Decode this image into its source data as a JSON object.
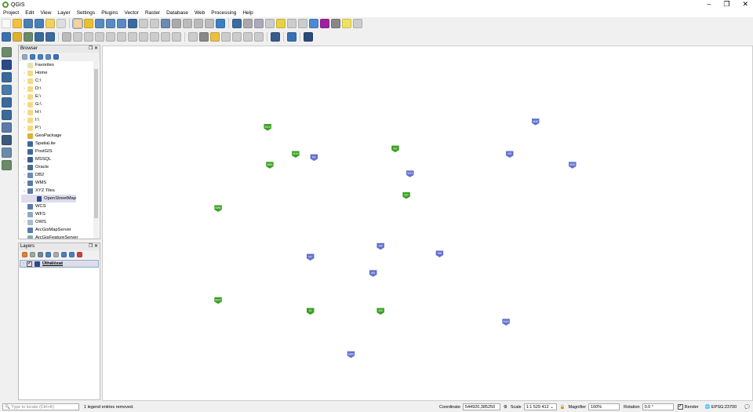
{
  "window": {
    "title": "QGIS",
    "minimize": "–",
    "restore": "❐",
    "close": "✕"
  },
  "menu": [
    "Project",
    "Edit",
    "View",
    "Layer",
    "Settings",
    "Plugins",
    "Vector",
    "Raster",
    "Database",
    "Web",
    "Processing",
    "Help"
  ],
  "toolbar1": [
    {
      "name": "new-project-icon",
      "color": "#f8f8f8"
    },
    {
      "name": "open-project-icon",
      "color": "#f0c040"
    },
    {
      "name": "save-project-icon",
      "color": "#4a7fb5"
    },
    {
      "name": "save-as-icon",
      "color": "#4a7fb5"
    },
    {
      "name": "new-print-layout-icon",
      "color": "#f0d060"
    },
    {
      "name": "layout-manager-icon",
      "color": "#ddd"
    },
    {
      "sep": true
    },
    {
      "name": "pan-icon",
      "color": "#f5d0a0",
      "sel": true
    },
    {
      "name": "pan-to-selection-icon",
      "color": "#e8c030"
    },
    {
      "name": "zoom-in-icon",
      "color": "#5a8ac0"
    },
    {
      "name": "zoom-out-icon",
      "color": "#5a8ac0"
    },
    {
      "name": "zoom-native-icon",
      "color": "#5a8ac0"
    },
    {
      "name": "zoom-full-icon",
      "color": "#3a6aa0"
    },
    {
      "name": "zoom-selection-icon",
      "color": "#ccc"
    },
    {
      "name": "zoom-layer-icon",
      "color": "#ccc"
    },
    {
      "name": "zoom-last-icon",
      "color": "#6a8ab0"
    },
    {
      "name": "zoom-next-icon",
      "color": "#aaa"
    },
    {
      "name": "new-map-view-icon",
      "color": "#bbb"
    },
    {
      "name": "new-3d-view-icon",
      "color": "#bbb"
    },
    {
      "name": "bookmarks-icon",
      "color": "#bbb"
    },
    {
      "name": "refresh-icon",
      "color": "#3a80c0"
    },
    {
      "sep": true
    },
    {
      "name": "identify-icon",
      "color": "#3a6aa0"
    },
    {
      "name": "action-icon",
      "color": "#aaa"
    },
    {
      "name": "select-icon",
      "color": "#aab"
    },
    {
      "name": "deselect-icon",
      "color": "#ccc"
    },
    {
      "name": "attribute-table-icon",
      "color": "#e8d040"
    },
    {
      "name": "field-calc-icon",
      "color": "#ccc"
    },
    {
      "name": "stats-icon",
      "color": "#ccc"
    },
    {
      "name": "toolbox-icon",
      "color": "#4a8ad0"
    },
    {
      "name": "sigma-icon",
      "color": "#a020a0"
    },
    {
      "name": "measure-icon",
      "color": "#888"
    },
    {
      "name": "map-tips-icon",
      "color": "#f0e060"
    },
    {
      "name": "text-annotation-icon",
      "color": "#ccc"
    }
  ],
  "toolbar2": [
    {
      "name": "data-source-manager-icon",
      "color": "#3a70b0"
    },
    {
      "name": "new-geopackage-icon",
      "color": "#e0b030"
    },
    {
      "name": "new-shapefile-icon",
      "color": "#6a8a6a"
    },
    {
      "name": "new-spatialite-icon",
      "color": "#3a6a9a"
    },
    {
      "name": "new-virtual-layer-icon",
      "color": "#3a6aa0"
    },
    {
      "sep": true
    },
    {
      "name": "current-edits-icon",
      "color": "#bbb"
    },
    {
      "name": "toggle-editing-icon",
      "color": "#ccc"
    },
    {
      "name": "save-edits-icon",
      "color": "#ccc"
    },
    {
      "name": "add-feature-icon",
      "color": "#ccc"
    },
    {
      "name": "vertex-tool-icon",
      "color": "#ccc"
    },
    {
      "name": "delete-selected-icon",
      "color": "#ccc"
    },
    {
      "name": "cut-icon",
      "color": "#ccc"
    },
    {
      "name": "copy-icon",
      "color": "#ccc"
    },
    {
      "name": "paste-icon",
      "color": "#ccc"
    },
    {
      "name": "undo-icon",
      "color": "#ccc"
    },
    {
      "name": "redo-icon",
      "color": "#ccc"
    },
    {
      "sep": true
    },
    {
      "name": "label-icon",
      "color": "#ccc"
    },
    {
      "name": "pin-labels-icon",
      "color": "#888"
    },
    {
      "name": "layer-labeling-icon",
      "color": "#e8c040"
    },
    {
      "name": "show-hide-labels-icon",
      "color": "#ccc"
    },
    {
      "name": "move-label-icon",
      "color": "#ccc"
    },
    {
      "name": "rotate-label-icon",
      "color": "#ccc"
    },
    {
      "name": "change-label-icon",
      "color": "#ccc"
    },
    {
      "sep": true
    },
    {
      "name": "globe-plugin-icon",
      "color": "#3a5a8a"
    },
    {
      "sep": true
    },
    {
      "name": "python-console-icon",
      "color": "#3a70b0"
    },
    {
      "sep": true
    },
    {
      "name": "help-icon",
      "color": "#2a4a7a"
    }
  ],
  "left_toolbar": [
    {
      "name": "add-vector-layer-icon",
      "color": "#6a8a6a"
    },
    {
      "name": "add-raster-layer-icon",
      "color": "#2a4a8a"
    },
    {
      "name": "add-mesh-layer-icon",
      "color": "#3a6a9a"
    },
    {
      "name": "add-delimited-text-icon",
      "color": "#4a7aaa"
    },
    {
      "name": "add-spatialite-icon",
      "color": "#3a6a9a"
    },
    {
      "name": "add-postgis-icon",
      "color": "#3a6a9a"
    },
    {
      "name": "add-wms-icon",
      "color": "#5a7aaa"
    },
    {
      "name": "add-wcs-icon",
      "color": "#3a5a7a"
    },
    {
      "name": "add-wfs-icon",
      "color": "#6a8aaa"
    },
    {
      "name": "new-temporary-layer-icon",
      "color": "#6a8a6a"
    }
  ],
  "browser": {
    "title": "Browser",
    "tools": [
      {
        "name": "add-selected-icon",
        "color": "#9ab"
      },
      {
        "name": "refresh-icon",
        "color": "#3a80c0"
      },
      {
        "name": "filter-icon",
        "color": "#4a80c0"
      },
      {
        "name": "collapse-icon",
        "color": "#5a8ac0"
      },
      {
        "name": "properties-icon",
        "color": "#3a70c0"
      }
    ],
    "items": [
      {
        "label": "Favorites",
        "arrow": "",
        "color": "#e8e0b0",
        "indent": 0
      },
      {
        "label": "Home",
        "arrow": "›",
        "color": "#f8d880",
        "indent": 0
      },
      {
        "label": "C:\\",
        "arrow": "›",
        "color": "#f8d880",
        "indent": 0
      },
      {
        "label": "D:\\",
        "arrow": "›",
        "color": "#f8d880",
        "indent": 0
      },
      {
        "label": "E:\\",
        "arrow": "›",
        "color": "#f8d880",
        "indent": 0
      },
      {
        "label": "G:\\",
        "arrow": "›",
        "color": "#f8d880",
        "indent": 0
      },
      {
        "label": "H:\\",
        "arrow": "›",
        "color": "#f8d880",
        "indent": 0
      },
      {
        "label": "I:\\",
        "arrow": "›",
        "color": "#f8d880",
        "indent": 0
      },
      {
        "label": "P:\\",
        "arrow": "›",
        "color": "#f8d880",
        "indent": 0
      },
      {
        "label": "GeoPackage",
        "arrow": "",
        "color": "#e0b030",
        "indent": 0
      },
      {
        "label": "SpatiaLite",
        "arrow": "",
        "color": "#3a6a9a",
        "indent": 0
      },
      {
        "label": "PostGIS",
        "arrow": "",
        "color": "#3a6a9a",
        "indent": 0
      },
      {
        "label": "MSSQL",
        "arrow": "›",
        "color": "#3a5a8a",
        "indent": 0
      },
      {
        "label": "Oracle",
        "arrow": "›",
        "color": "#4a6a8a",
        "indent": 0
      },
      {
        "label": "DB2",
        "arrow": "›",
        "color": "#6a8aba",
        "indent": 0
      },
      {
        "label": "WMS",
        "arrow": "›",
        "color": "#5a7aaa",
        "indent": 0
      },
      {
        "label": "XYZ Tiles",
        "arrow": "⌄",
        "color": "#5a7aaa",
        "indent": 0
      },
      {
        "label": "OpenStreetMap",
        "arrow": "",
        "color": "#2a4a8a",
        "indent": 1,
        "selected": true
      },
      {
        "label": "WCS",
        "arrow": "",
        "color": "#5a7aaa",
        "indent": 0
      },
      {
        "label": "WFS",
        "arrow": "›",
        "color": "#8aaacc",
        "indent": 0
      },
      {
        "label": "OWS",
        "arrow": "›",
        "color": "#aabbcc",
        "indent": 0
      },
      {
        "label": "ArcGisMapServer",
        "arrow": "",
        "color": "#5a7aaa",
        "indent": 0
      },
      {
        "label": "ArcGisFeatureServer",
        "arrow": "",
        "color": "#8aa",
        "indent": 0
      }
    ]
  },
  "layers": {
    "title": "Layers",
    "tools": [
      {
        "name": "styling-icon",
        "color": "#e08030"
      },
      {
        "name": "add-group-icon",
        "color": "#9a9"
      },
      {
        "name": "manage-themes-icon",
        "color": "#789"
      },
      {
        "name": "filter-legend-icon",
        "color": "#4a80c0"
      },
      {
        "name": "filter-expression-icon",
        "color": "#aaa"
      },
      {
        "name": "expand-all-icon",
        "color": "#4a80c0"
      },
      {
        "name": "collapse-all-icon",
        "color": "#4a80c0"
      },
      {
        "name": "remove-layer-icon",
        "color": "#d04040"
      }
    ],
    "items": [
      {
        "label": "Úthálózat",
        "checked": true
      }
    ]
  },
  "map": {
    "shields": [
      {
        "label": "M15",
        "color": "#3aa020",
        "lon": 17.27,
        "lat": 48.0
      },
      {
        "label": "M85",
        "color": "#3aa020",
        "lon": 17.3,
        "lat": 47.65
      },
      {
        "label": "M19",
        "color": "#3aa020",
        "lon": 17.65,
        "lat": 47.75
      },
      {
        "label": "M1",
        "color": "#6070d0",
        "lon": 17.9,
        "lat": 47.72
      },
      {
        "label": "M2",
        "color": "#3aa020",
        "lon": 19.0,
        "lat": 47.8
      },
      {
        "label": "M31",
        "color": "#6070d0",
        "lon": 19.2,
        "lat": 47.57
      },
      {
        "label": "M0",
        "color": "#3aa020",
        "lon": 19.15,
        "lat": 47.37
      },
      {
        "label": "M86",
        "color": "#3aa020",
        "lon": 16.6,
        "lat": 47.25
      },
      {
        "label": "M7",
        "color": "#6070d0",
        "lon": 17.85,
        "lat": 46.8
      },
      {
        "label": "M6",
        "color": "#6070d0",
        "lon": 18.8,
        "lat": 46.9
      },
      {
        "label": "M5",
        "color": "#6070d0",
        "lon": 19.6,
        "lat": 46.83
      },
      {
        "label": "M6",
        "color": "#6070d0",
        "lon": 18.7,
        "lat": 46.65
      },
      {
        "label": "M70",
        "color": "#3aa020",
        "lon": 16.6,
        "lat": 46.4
      },
      {
        "label": "61",
        "color": "#3aa020",
        "lon": 17.85,
        "lat": 46.3
      },
      {
        "label": "M9",
        "color": "#3aa020",
        "lon": 18.8,
        "lat": 46.3
      },
      {
        "label": "M43",
        "color": "#6070d0",
        "lon": 20.5,
        "lat": 46.2
      },
      {
        "label": "M60",
        "color": "#6070d0",
        "lon": 18.4,
        "lat": 45.9
      },
      {
        "label": "M30",
        "color": "#6070d0",
        "lon": 20.9,
        "lat": 48.05
      },
      {
        "label": "M3",
        "color": "#6070d0",
        "lon": 20.55,
        "lat": 47.75
      },
      {
        "label": "M30",
        "color": "#6070d0",
        "lon": 21.4,
        "lat": 47.65
      }
    ]
  },
  "status": {
    "locate_placeholder": "Type to locate (Ctrl+K)",
    "message": "1 legend entries removed.",
    "coordinate_label": "Coordinate",
    "coordinate": "544920,385250",
    "scale_label": "Scale",
    "scale": "1:1 529 412",
    "magnifier_label": "Magnifier",
    "magnifier": "100%",
    "rotation_label": "Rotation",
    "rotation": "0.0 °",
    "render_label": "Render",
    "render_checked": true,
    "crs": "EPSG:23700"
  }
}
